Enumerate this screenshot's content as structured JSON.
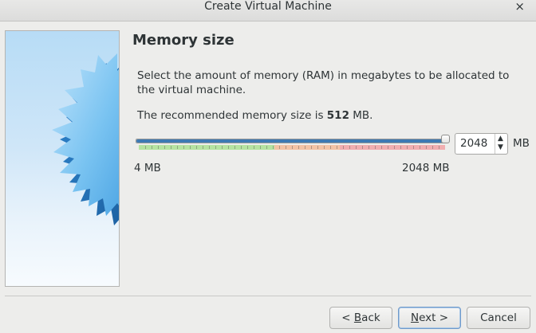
{
  "window": {
    "title": "Create Virtual Machine",
    "close_label": "×"
  },
  "page": {
    "heading": "Memory size",
    "description": "Select the amount of memory (RAM) in megabytes to be allocated to the virtual machine.",
    "recommend_prefix": "The recommended memory size is ",
    "recommend_value": "512",
    "recommend_suffix": " MB."
  },
  "memory": {
    "slider_min_label": "4 MB",
    "slider_max_label": "2048 MB",
    "slider_value_fraction": 1.0,
    "value": "2048",
    "unit": "MB",
    "spin_up_glyph": "▲",
    "spin_down_glyph": "▼"
  },
  "buttons": {
    "back_prefix": "< ",
    "back_mnemonic": "B",
    "back_rest": "ack",
    "next_mnemonic": "N",
    "next_rest": "ext >",
    "cancel": "Cancel"
  },
  "colors": {
    "slider_fill": "#3d7ab4",
    "scale_green": "#b6e3a1",
    "scale_orange": "#f3c3a5",
    "scale_red": "#f1aeb0",
    "star_blue": "#5fb2ec"
  }
}
